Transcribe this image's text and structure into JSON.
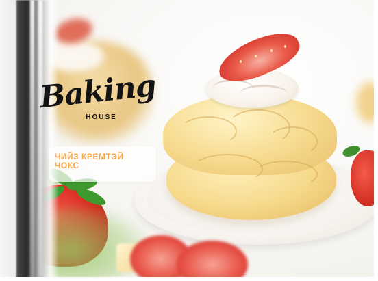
{
  "brand": {
    "logo_script": "Baking",
    "logo_sub": "HOUSE"
  },
  "caption": {
    "line1": "ЧИЙЗ КРЕМТЭЙ",
    "line2": "ЧОКС"
  },
  "colors": {
    "caption_text": "#f1a84d",
    "logo_text": "#141414",
    "choux": "#f6d98a",
    "strawberry": "#d8281f",
    "cream": "#f8f2ea"
  },
  "icons": [
    "strawberry",
    "choux-pastry",
    "plate"
  ]
}
